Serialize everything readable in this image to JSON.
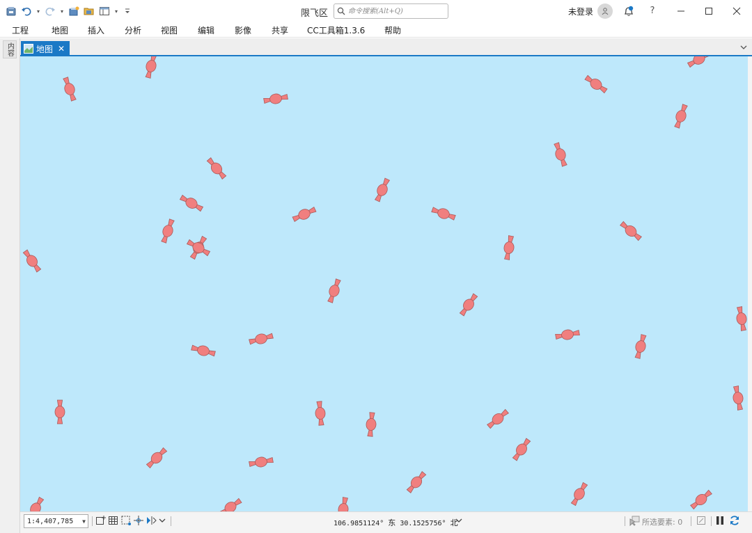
{
  "title_bar": {
    "app_title": "限飞区",
    "search_placeholder": "命令搜索(Alt+Q)",
    "login_text": "未登录",
    "help_label": "?",
    "quick_access_icons": [
      "project-icon",
      "undo-icon",
      "redo-icon",
      "new-project-icon",
      "open-project-icon",
      "window-layout-icon",
      "customize-toolbar-icon"
    ],
    "window_controls": [
      "minimize-icon",
      "maximize-icon",
      "close-icon"
    ]
  },
  "menu": {
    "items": [
      "工程",
      "地图",
      "插入",
      "分析",
      "视图",
      "编辑",
      "影像",
      "共享",
      "CC工具箱1.3.6",
      "帮助"
    ]
  },
  "side_panel": {
    "tab_label": "内容"
  },
  "map_view": {
    "tab_label": "地图",
    "background_color": "#bee8fb",
    "feature_fill_color": "#f07f7f",
    "feature_stroke_color": "#a85a5a",
    "feature_count_visible": 50
  },
  "status_bar": {
    "scale": "1:4,407,785",
    "longitude": "106.9851124°",
    "longitude_dir": "东",
    "latitude": "30.1525756°",
    "latitude_dir": "北",
    "selected_label": "所选要素",
    "selected_count": "0"
  }
}
